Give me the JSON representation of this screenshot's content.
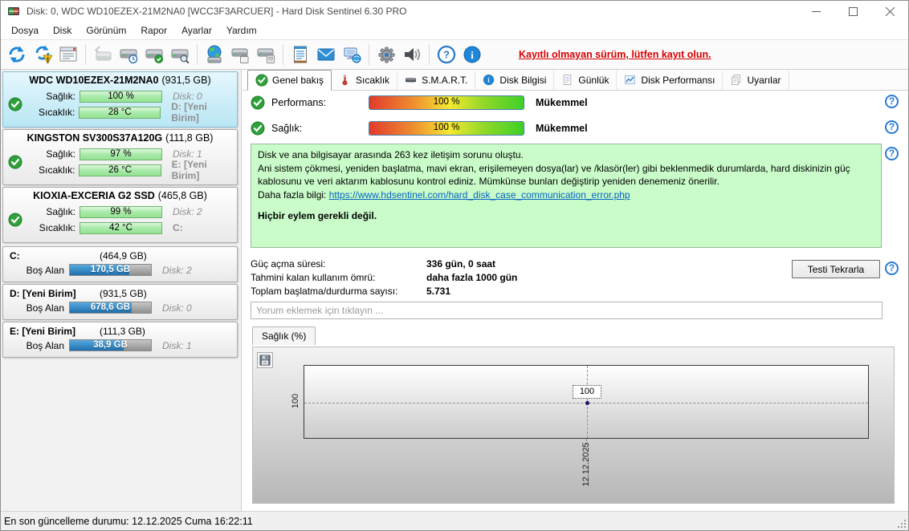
{
  "window": {
    "title": "Disk: 0, WDC WD10EZEX-21M2NA0 [WCC3F3ARCUER]  -  Hard Disk Sentinel 6.30 PRO"
  },
  "menu": {
    "items": [
      "Dosya",
      "Disk",
      "Görünüm",
      "Rapor",
      "Ayarlar",
      "Yardım"
    ]
  },
  "toolbar": {
    "notice": "Kayıtlı olmayan sürüm, lütfen kayıt olun.",
    "icons": [
      "refresh",
      "refresh-alert",
      "report-window",
      "disk-undo",
      "disk-schedule",
      "disk-accept",
      "disk-analyze",
      "disk-network",
      "disk-remove",
      "disk-mount",
      "log",
      "mail",
      "network-status",
      "settings-gear",
      "sound",
      "help",
      "info"
    ]
  },
  "icons": {
    "help_glyph": "?",
    "info_glyph": "i"
  },
  "tabs": {
    "items": [
      "Genel bakış",
      "Sıcaklık",
      "S.M.A.R.T.",
      "Disk Bilgisi",
      "Günlük",
      "Disk Performansı",
      "Uyarılar"
    ],
    "active": "Genel bakış"
  },
  "sidebar": {
    "disks": [
      {
        "name": "WDC WD10EZEX-21M2NA0",
        "size": "(931,5 GB)",
        "health_label": "Sağlık:",
        "health_value": "100 %",
        "temp_label": "Sıcaklık:",
        "temp_value": "28 °C",
        "disk_index": "Disk: 0",
        "volumes": "D: [Yeni Birim]"
      },
      {
        "name": "KINGSTON SV300S37A120G",
        "size": "(111,8 GB)",
        "health_label": "Sağlık:",
        "health_value": "97 %",
        "temp_label": "Sıcaklık:",
        "temp_value": "26 °C",
        "disk_index": "Disk: 1",
        "volumes": "E: [Yeni Birim]"
      },
      {
        "name": "KIOXIA-EXCERIA G2 SSD",
        "size": "(465,8 GB)",
        "health_label": "Sağlık:",
        "health_value": "99 %",
        "temp_label": "Sıcaklık:",
        "temp_value": "42 °C",
        "disk_index": "Disk: 2",
        "volumes": "C:"
      }
    ],
    "partitions": [
      {
        "name": "C:",
        "size": "(464,9 GB)",
        "free_label": "Boş Alan",
        "free_value": "170,5 GB",
        "disk_index": "Disk: 2",
        "bar_pct": 73
      },
      {
        "name": "D: [Yeni Birim]",
        "size": "(931,5 GB)",
        "free_label": "Boş Alan",
        "free_value": "678,6 GB",
        "disk_index": "Disk: 0",
        "bar_pct": 76
      },
      {
        "name": "E: [Yeni Birim]",
        "size": "(111,3 GB)",
        "free_label": "Boş Alan",
        "free_value": "38,9 GB",
        "disk_index": "Disk: 1",
        "bar_pct": 66
      }
    ]
  },
  "overview": {
    "performance_label": "Performans:",
    "performance_value": "100 %",
    "performance_rating": "Mükemmel",
    "health_label": "Sağlık:",
    "health_value": "100 %",
    "health_rating": "Mükemmel",
    "message_line1": "Disk ve ana bilgisayar arasında 263 kez iletişim sorunu oluştu.",
    "message_line2": "Ani sistem çökmesi, yeniden başlatma, mavi ekran, erişilemeyen dosya(lar) ve /klasör(ler) gibi beklenmedik durumlarda, hard diskinizin güç kablosunu ve veri aktarım kablosunu kontrol ediniz. Mümkünse bunları değiştirip yeniden denemeniz önerilir.",
    "more_info_label": "Daha fazla bilgi: ",
    "more_info_link": "https://www.hdsentinel.com/hard_disk_case_communication_error.php",
    "no_action": "Hiçbir eylem gerekli değil.",
    "stats": [
      {
        "label": "Güç açma süresi:",
        "value": "336 gün, 0 saat"
      },
      {
        "label": "Tahmini kalan kullanım ömrü:",
        "value": "daha fazla 1000 gün"
      },
      {
        "label": "Toplam başlatma/durdurma sayısı:",
        "value": "5.731"
      }
    ],
    "retest_button": "Testi Tekrarla",
    "comment_placeholder": "Yorum eklemek için tıklayın ..."
  },
  "chart_data": {
    "type": "line",
    "tab_label": "Sağlık (%)",
    "x": [
      "12.12.2025"
    ],
    "series": [
      {
        "name": "Sağlık (%)",
        "values": [
          100
        ]
      }
    ],
    "y_tick": "100",
    "point_label": "100",
    "x_label": "12.12.2025",
    "ylim": [
      0,
      100
    ],
    "grid": "dashed-crosshair",
    "legend": "none"
  },
  "status_bar": {
    "text": "En son güncelleme durumu: 12.12.2025 Cuma 16:22:11"
  },
  "colors": {
    "selected_panel": "#bfe9f6",
    "health_bar": "#9ade9a",
    "free_bar": "#2b7fc2",
    "notice_red": "#d40000",
    "message_bg": "#c9fcc9",
    "link_blue": "#0563c1"
  }
}
